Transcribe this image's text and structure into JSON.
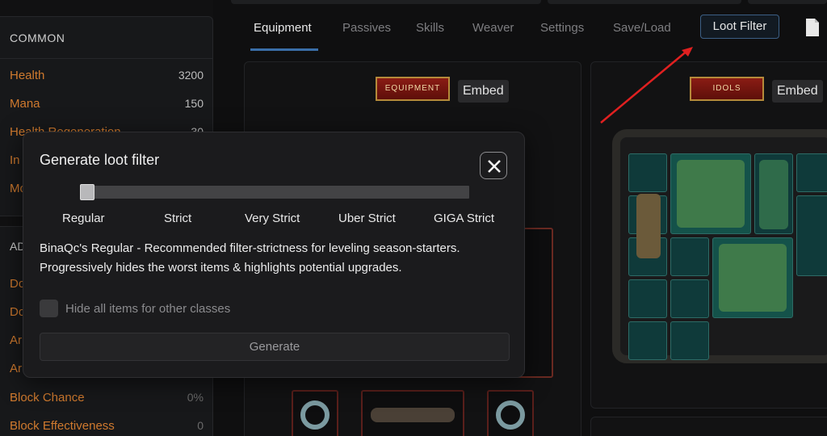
{
  "sidebar": {
    "section_common": "COMMON",
    "section_second": "AD",
    "stats_top": [
      {
        "label": "Health",
        "value": "3200"
      },
      {
        "label": "Mana",
        "value": "150"
      },
      {
        "label": "Health Regeneration",
        "value": "30"
      },
      {
        "label": "In",
        "value": ""
      },
      {
        "label": "Mo",
        "value": ""
      }
    ],
    "stats_bottom": [
      {
        "label": "Do",
        "value": ""
      },
      {
        "label": "Do",
        "value": ""
      },
      {
        "label": "Ar",
        "value": ""
      },
      {
        "label": "Ar",
        "value": ""
      },
      {
        "label": "Block Chance",
        "value": "0%"
      },
      {
        "label": "Block Effectiveness",
        "value": "0"
      }
    ]
  },
  "tabs": [
    {
      "label": "Equipment"
    },
    {
      "label": "Passives"
    },
    {
      "label": "Skills"
    },
    {
      "label": "Weaver"
    },
    {
      "label": "Settings"
    },
    {
      "label": "Save/Load"
    }
  ],
  "loot_filter_button": "Loot Filter",
  "equipment_pane": {
    "banner": "EQUIPMENT",
    "embed": "Embed"
  },
  "idols_pane": {
    "banner": "IDOLS",
    "embed": "Embed"
  },
  "dialog": {
    "title": "Generate loot filter",
    "levels": [
      "Regular",
      "Strict",
      "Very Strict",
      "Uber Strict",
      "GIGA Strict"
    ],
    "slider_value": 0,
    "description_line1": "BinaQc's Regular - Recommended filter-strictness for leveling season-starters.",
    "description_line2": "Progressively hides the worst items & highlights potential upgrades.",
    "checkbox_label": "Hide all items for other classes",
    "checkbox_checked": false,
    "generate_button": "Generate"
  },
  "colors": {
    "accent": "#3a6ea8",
    "stat_label": "#d07a2e",
    "annotation_arrow": "#e02020"
  }
}
